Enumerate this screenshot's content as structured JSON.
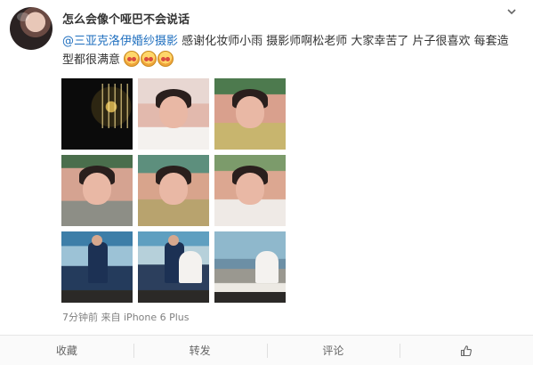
{
  "post": {
    "username": "怎么会像个哑巴不会说话",
    "mention": "@三亚克洛伊婚纱摄影",
    "text": " 感谢化妆师小雨 摄影师啊松老师 大家幸苦了 片子很喜欢 每套造型都很满意",
    "emoji_count": 3,
    "time": "7分钟前",
    "source_prefix": "来自",
    "source": "iPhone 6 Plus"
  },
  "actions": {
    "favorite": "收藏",
    "repost": "转发",
    "comment": "评论"
  },
  "icons": {
    "menu": "chevron-down-icon",
    "like": "thumbs-up-icon",
    "emoji": "blush-emoji-icon"
  },
  "colors": {
    "link": "#1f6fbf",
    "text": "#333333",
    "meta": "#808080"
  }
}
